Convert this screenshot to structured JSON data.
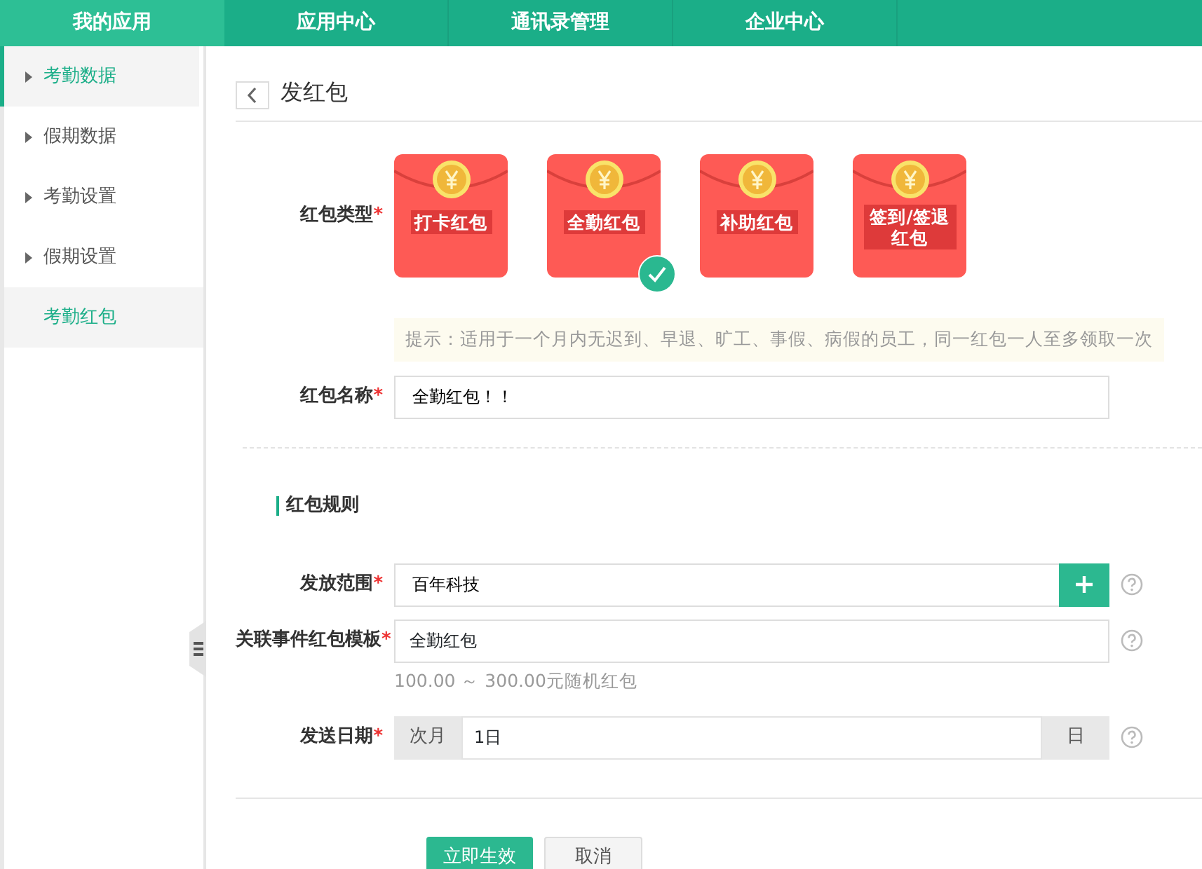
{
  "nav": {
    "tabs": [
      {
        "label": "我的应用",
        "selected": true
      },
      {
        "label": "应用中心",
        "selected": false
      },
      {
        "label": "通讯录管理",
        "selected": false
      },
      {
        "label": "企业中心",
        "selected": false
      }
    ]
  },
  "sidebar": {
    "items": [
      {
        "label": "考勤数据",
        "kind": "group",
        "highlighted": true
      },
      {
        "label": "假期数据",
        "kind": "group",
        "highlighted": false
      },
      {
        "label": "考勤设置",
        "kind": "group",
        "highlighted": false
      },
      {
        "label": "假期设置",
        "kind": "group",
        "highlighted": false
      },
      {
        "label": "考勤红包",
        "kind": "link",
        "highlighted": true
      }
    ]
  },
  "page": {
    "title": "发红包"
  },
  "form": {
    "type_field": {
      "label": "红包类型",
      "required_mark": "*",
      "options": [
        {
          "label": "打卡红包",
          "selected": false
        },
        {
          "label": "全勤红包",
          "selected": true
        },
        {
          "label": "补助红包",
          "selected": false
        },
        {
          "label": "签到/签退红包",
          "selected": false
        }
      ],
      "hint": "提示：适用于一个月内无迟到、早退、旷工、事假、病假的员工，同一红包一人至多领取一次"
    },
    "name_field": {
      "label": "红包名称",
      "required_mark": "*",
      "value": "全勤红包！！"
    },
    "section_title": "红包规则",
    "scope_field": {
      "label": "发放范围",
      "required_mark": "*",
      "value": "百年科技"
    },
    "template_field": {
      "label": "关联事件红包模板",
      "required_mark": "*",
      "value": "全勤红包",
      "note": "100.00 ～ 300.00元随机红包"
    },
    "date_field": {
      "label": "发送日期",
      "required_mark": "*",
      "prefix": "次月",
      "value": "1日",
      "suffix": "日"
    },
    "buttons": [
      {
        "label": "立即生效",
        "kind": "primary"
      },
      {
        "label": "取消",
        "kind": "secondary"
      }
    ]
  }
}
